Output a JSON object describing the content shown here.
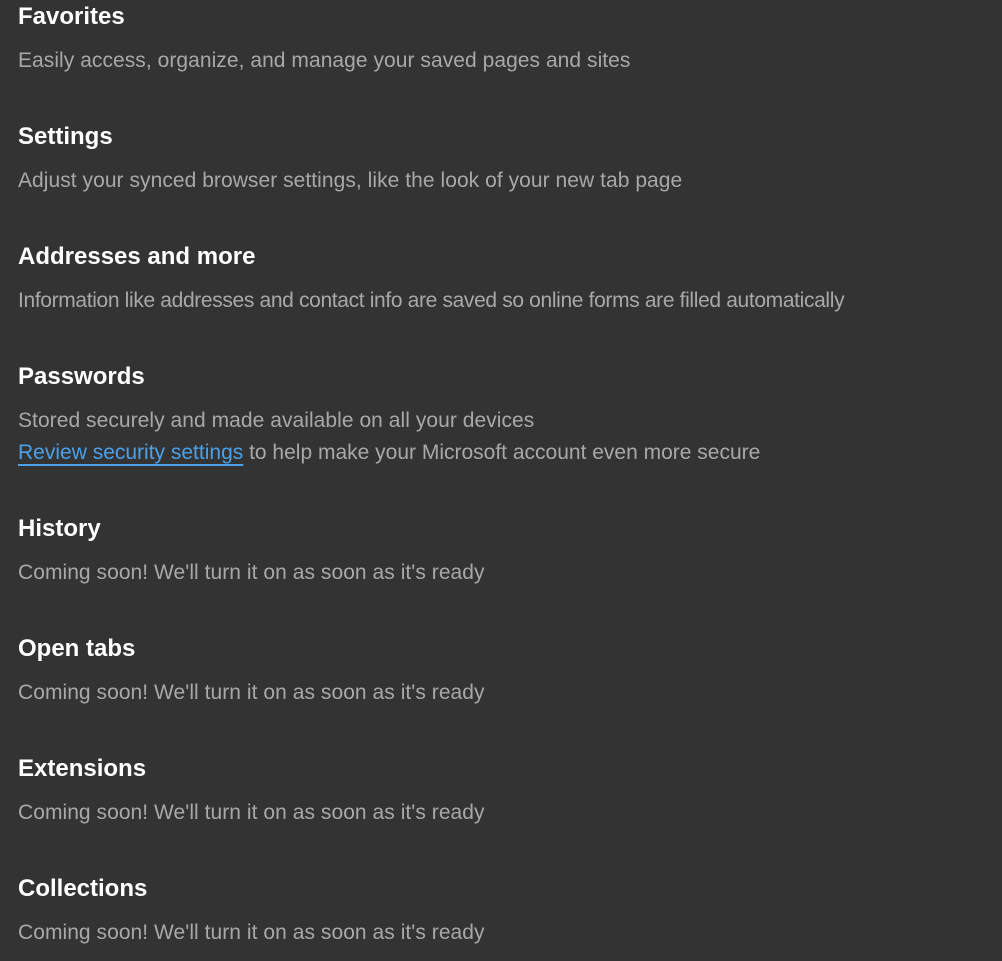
{
  "sections": [
    {
      "title": "Favorites",
      "description": "Easily access, organize, and manage your saved pages and sites"
    },
    {
      "title": "Settings",
      "description": "Adjust your synced browser settings, like the look of your new tab page"
    },
    {
      "title": "Addresses and more",
      "description": "Information like addresses and contact info are saved so online forms are filled automatically"
    },
    {
      "title": "Passwords",
      "description": "Stored securely and made available on all your devices",
      "link_text": "Review security settings",
      "link_suffix": " to help make your Microsoft account even more secure"
    },
    {
      "title": "History",
      "description": "Coming soon! We'll turn it on as soon as it's ready"
    },
    {
      "title": "Open tabs",
      "description": "Coming soon! We'll turn it on as soon as it's ready"
    },
    {
      "title": "Extensions",
      "description": "Coming soon! We'll turn it on as soon as it's ready"
    },
    {
      "title": "Collections",
      "description": "Coming soon! We'll turn it on as soon as it's ready"
    }
  ],
  "colors": {
    "background": "#333333",
    "title": "#ffffff",
    "description": "#a8a8a8",
    "link": "#4ba0e8"
  }
}
